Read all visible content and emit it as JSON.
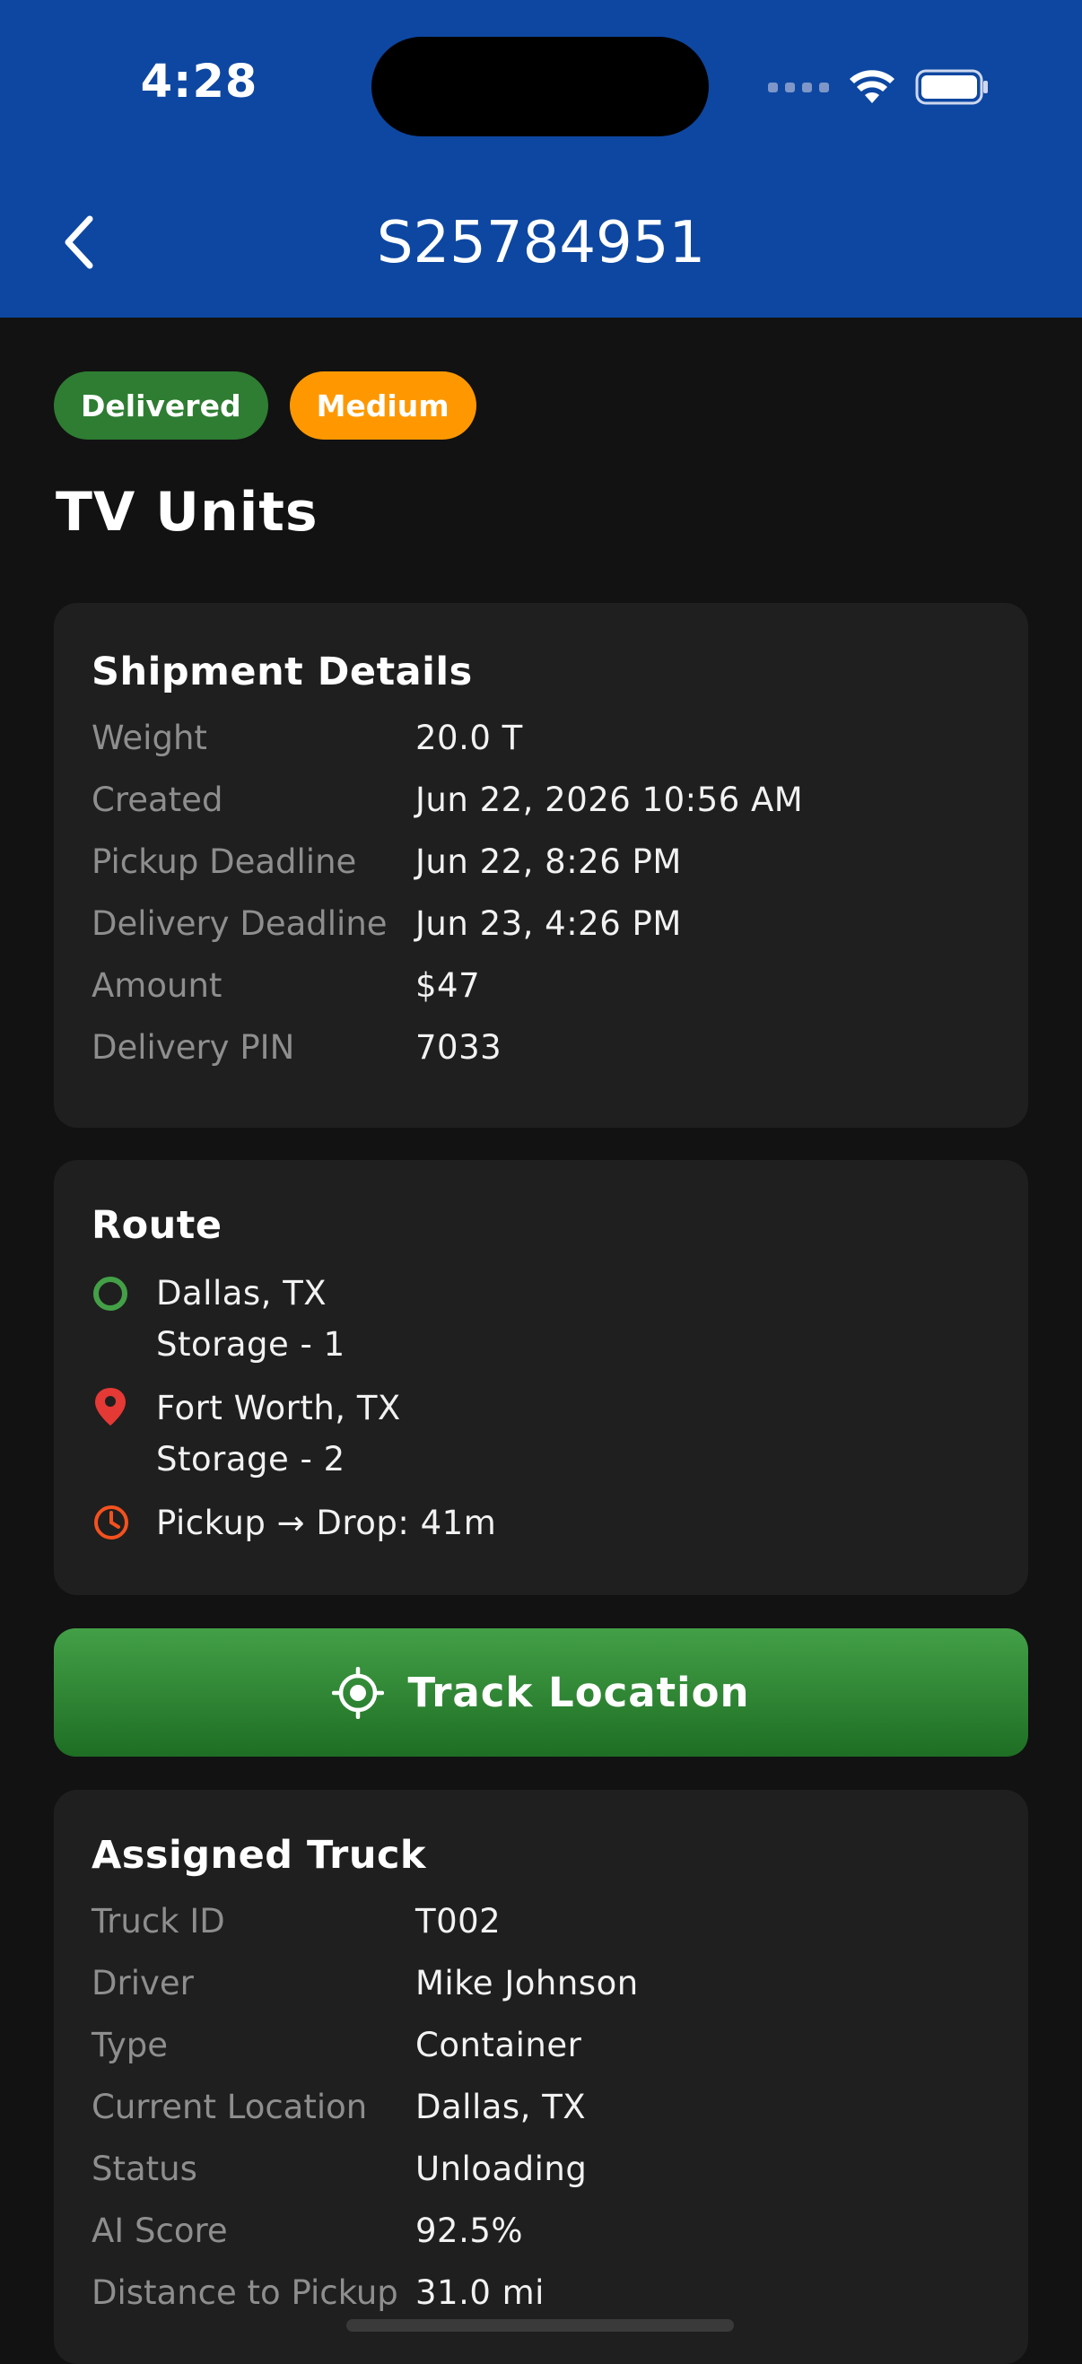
{
  "status_bar": {
    "time": "4:28"
  },
  "header": {
    "title": "S25784951",
    "back_icon": "chevron-left-icon"
  },
  "badges": [
    {
      "label": "Delivered",
      "color": "#2e7d32"
    },
    {
      "label": "Medium",
      "color": "#ff9800"
    }
  ],
  "item_title": "TV Units",
  "shipment_details": {
    "heading": "Shipment Details",
    "rows": [
      {
        "key": "Weight",
        "value": "20.0 T"
      },
      {
        "key": "Created",
        "value": "Jun 22, 2026 10:56 AM"
      },
      {
        "key": "Pickup Deadline",
        "value": "Jun 22, 8:26 PM"
      },
      {
        "key": "Delivery Deadline",
        "value": "Jun 23, 4:26 PM"
      },
      {
        "key": "Amount",
        "value": "$47"
      },
      {
        "key": "Delivery PIN",
        "value": "7033"
      }
    ]
  },
  "route": {
    "heading": "Route",
    "origin": {
      "city": "Dallas, TX",
      "place": "Storage - 1",
      "icon": "origin-ring-icon",
      "color": "#43a047"
    },
    "destination": {
      "city": "Fort Worth, TX",
      "place": "Storage - 2",
      "icon": "location-pin-icon",
      "color": "#e53935"
    },
    "duration": {
      "text": "Pickup → Drop: 41m",
      "icon": "clock-icon",
      "color": "#f4511e"
    }
  },
  "track_button": {
    "label": "Track Location",
    "icon": "gps-crosshair-icon"
  },
  "assigned_truck": {
    "heading": "Assigned Truck",
    "rows": [
      {
        "key": "Truck ID",
        "value": "T002"
      },
      {
        "key": "Driver",
        "value": "Mike Johnson"
      },
      {
        "key": "Type",
        "value": "Container"
      },
      {
        "key": "Current Location",
        "value": "Dallas, TX"
      },
      {
        "key": "Status",
        "value": "Unloading"
      },
      {
        "key": "AI Score",
        "value": "92.5%"
      },
      {
        "key": "Distance to Pickup",
        "value": "31.0 mi"
      }
    ]
  }
}
